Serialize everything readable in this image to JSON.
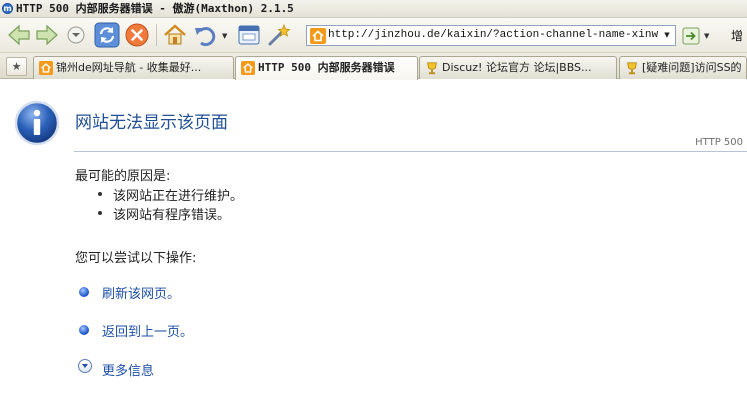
{
  "window": {
    "title": "HTTP 500 内部服务器错误 - 傲游(Maxthon) 2.1.5"
  },
  "toolbar": {
    "address_value": "http://jinzhou.de/kaixin/?action-channel-name-xinwen",
    "overflow_label": "增"
  },
  "tabs": [
    {
      "label": "锦州de网址导航 - 收集最好...",
      "active": false
    },
    {
      "label": "HTTP 500 内部服务器错误",
      "active": true
    },
    {
      "label": "Discuz! 论坛官方 论坛|BBS...",
      "active": false
    },
    {
      "label": "[疑难问题]访问SS的",
      "active": false
    }
  ],
  "error_page": {
    "title": "网站无法显示该页面",
    "http_code": "HTTP 500",
    "reasons_heading": "最可能的原因是:",
    "reasons": [
      "该网站正在进行维护。",
      "该网站有程序错误。"
    ],
    "try_heading": "您可以尝试以下操作:",
    "actions": [
      "刷新该网页。",
      "返回到上一页。"
    ],
    "more_info": "更多信息"
  },
  "colors": {
    "link": "#1d4fa6",
    "title": "#1f4f95",
    "accent_blue": "#2f6fc9"
  }
}
